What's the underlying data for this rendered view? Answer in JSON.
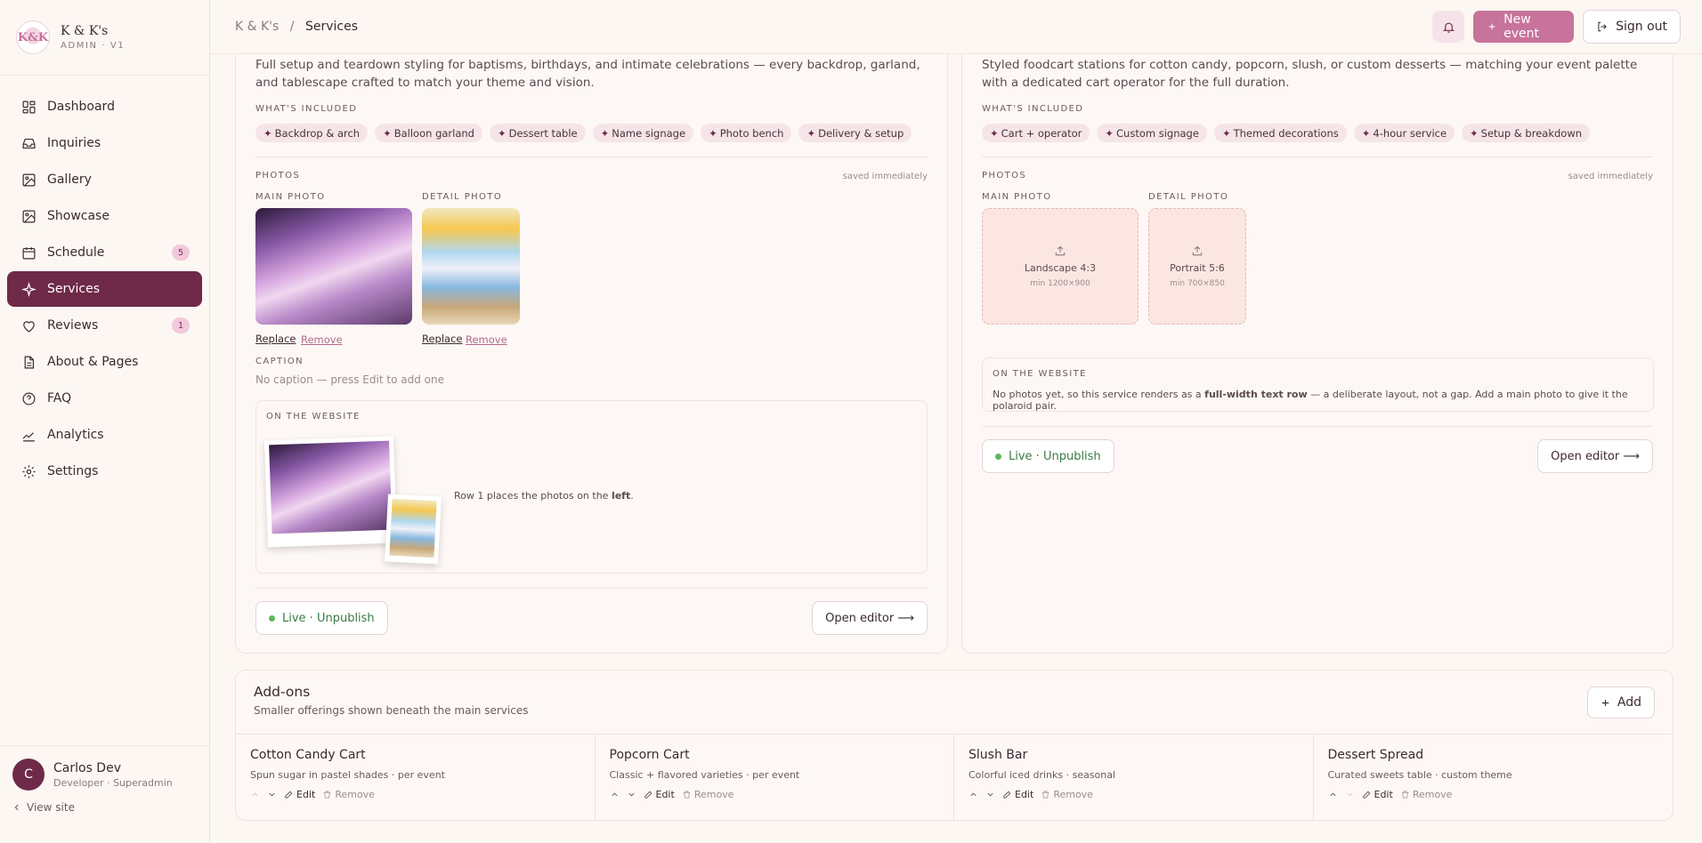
{
  "brand": {
    "logo_text": "K&K",
    "name": "K & K's",
    "subtitle": "ADMIN · V1"
  },
  "nav": [
    {
      "label": "Dashboard",
      "icon": "grid-icon"
    },
    {
      "label": "Inquiries",
      "icon": "inbox-icon"
    },
    {
      "label": "Gallery",
      "icon": "image-icon"
    },
    {
      "label": "Showcase",
      "icon": "picture-icon"
    },
    {
      "label": "Schedule",
      "icon": "calendar-icon",
      "badge": "5"
    },
    {
      "label": "Services",
      "icon": "sparkle-icon",
      "active": true
    },
    {
      "label": "Reviews",
      "icon": "heart-icon",
      "badge": "1"
    },
    {
      "label": "About & Pages",
      "icon": "document-icon"
    },
    {
      "label": "FAQ",
      "icon": "help-circle-icon"
    },
    {
      "label": "Analytics",
      "icon": "chart-icon"
    },
    {
      "label": "Settings",
      "icon": "gear-icon"
    }
  ],
  "user": {
    "initial": "C",
    "name": "Carlos Dev",
    "role": "Developer · Superadmin",
    "view_site": "View site"
  },
  "breadcrumb": {
    "root": "K & K's",
    "separator": "/",
    "current": "Services"
  },
  "top_actions": {
    "new_event": "New event",
    "sign_out": "Sign out"
  },
  "service_left": {
    "description": "Full setup and teardown styling for baptisms, birthdays, and intimate celebrations — every backdrop, garland, and tablescape crafted to match your theme and vision.",
    "included_label": "WHAT'S INCLUDED",
    "included": [
      "Backdrop & arch",
      "Balloon garland",
      "Dessert table",
      "Name signage",
      "Photo bench",
      "Delivery & setup"
    ],
    "photos_label": "PHOTOS",
    "saved_note": "saved immediately",
    "main_photo_label": "MAIN PHOTO",
    "detail_photo_label": "DETAIL PHOTO",
    "replace": "Replace",
    "remove": "Remove",
    "caption_label": "CAPTION",
    "caption_placeholder": "No caption — press Edit to add one",
    "website_label": "ON THE WEBSITE",
    "website_note_pre": "Row 1 places the photos on the ",
    "website_note_bold": "left",
    "website_note_post": ".",
    "status": "Live · Unpublish",
    "open_editor": "Open editor ⟶"
  },
  "service_right": {
    "description": "Styled foodcart stations for cotton candy, popcorn, slush, or custom desserts — matching your event palette with a dedicated cart operator for the full duration.",
    "included_label": "WHAT'S INCLUDED",
    "included": [
      "Cart + operator",
      "Custom signage",
      "Themed decorations",
      "4-hour service",
      "Setup & breakdown"
    ],
    "photos_label": "PHOTOS",
    "saved_note": "saved immediately",
    "main_photo_label": "MAIN PHOTO",
    "detail_photo_label": "DETAIL PHOTO",
    "main_upload_title": "Landscape 4:3",
    "main_upload_sub": "min 1200×900",
    "detail_upload_title": "Portrait 5:6",
    "detail_upload_sub": "min 700×850",
    "website_label": "ON THE WEBSITE",
    "website_note_pre": "No photos yet, so this service renders as a ",
    "website_note_bold": "full-width text row",
    "website_note_post": " — a deliberate layout, not a gap. Add a main photo to give it the polaroid pair.",
    "status": "Live · Unpublish",
    "open_editor": "Open editor ⟶"
  },
  "addons": {
    "title": "Add-ons",
    "subtitle": "Smaller offerings shown beneath the main services",
    "add_label": "Add",
    "edit_label": "Edit",
    "remove_label": "Remove",
    "items": [
      {
        "name": "Cotton Candy Cart",
        "desc": "Spun sugar in pastel shades · per event"
      },
      {
        "name": "Popcorn Cart",
        "desc": "Classic + flavored varieties · per event"
      },
      {
        "name": "Slush Bar",
        "desc": "Colorful iced drinks · seasonal"
      },
      {
        "name": "Dessert Spread",
        "desc": "Curated sweets table · custom theme"
      }
    ]
  },
  "colors": {
    "accent": "#6e2a48",
    "primary_button": "#c7739b",
    "chip": "#f6e5e8",
    "live": "#5cb85c"
  }
}
